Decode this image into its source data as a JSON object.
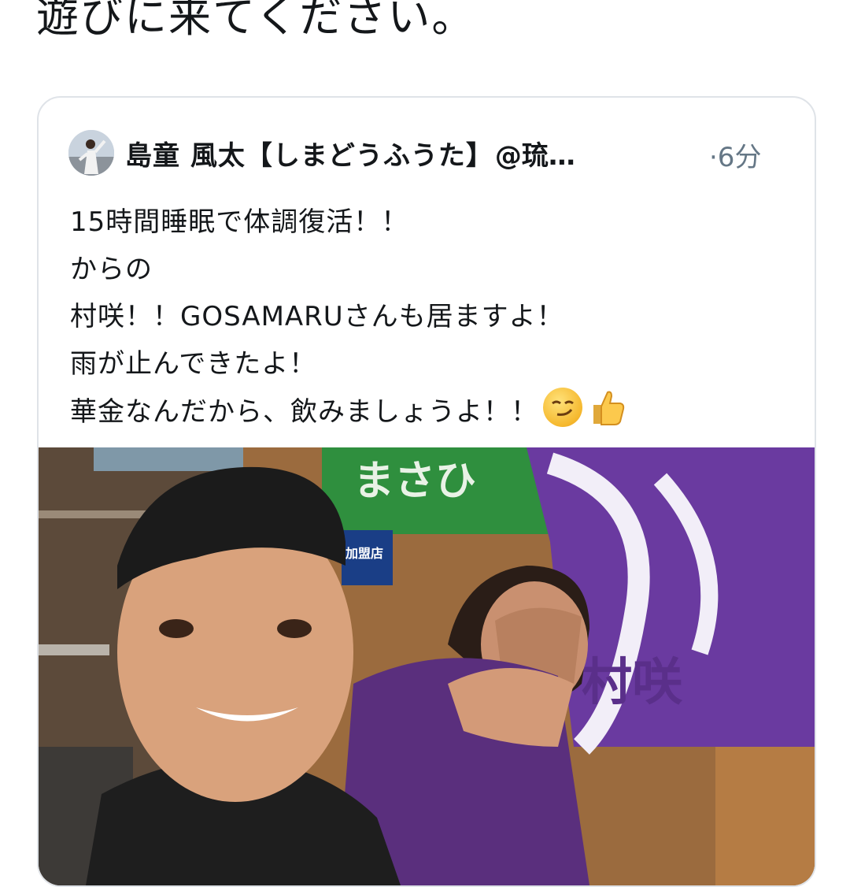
{
  "top_text": "遊びに来てください。",
  "quoted_tweet": {
    "author_name": "島童 風太【しまどうふうた】",
    "author_handle": "@琉…",
    "timestamp": "·6分",
    "lines": [
      "15時間睡眠で体調復活！！",
      "からの",
      "村咲！！GOSAMARUさんも居ますよ！",
      "雨が止んできたよ！",
      "華金なんだから、飲みましょうよ！！"
    ],
    "emojis": [
      "smirk-emoji",
      "thumbs-up-emoji"
    ],
    "photo": {
      "banner_green_text": "まさひ",
      "sign_text": "加盟店",
      "banner_purple_text": "村咲"
    }
  },
  "colors": {
    "text": "#14171a",
    "secondary": "#657786",
    "border": "#dfe3e8",
    "banner_green": "#2f8f3e",
    "banner_purple": "#6a3aa0"
  }
}
